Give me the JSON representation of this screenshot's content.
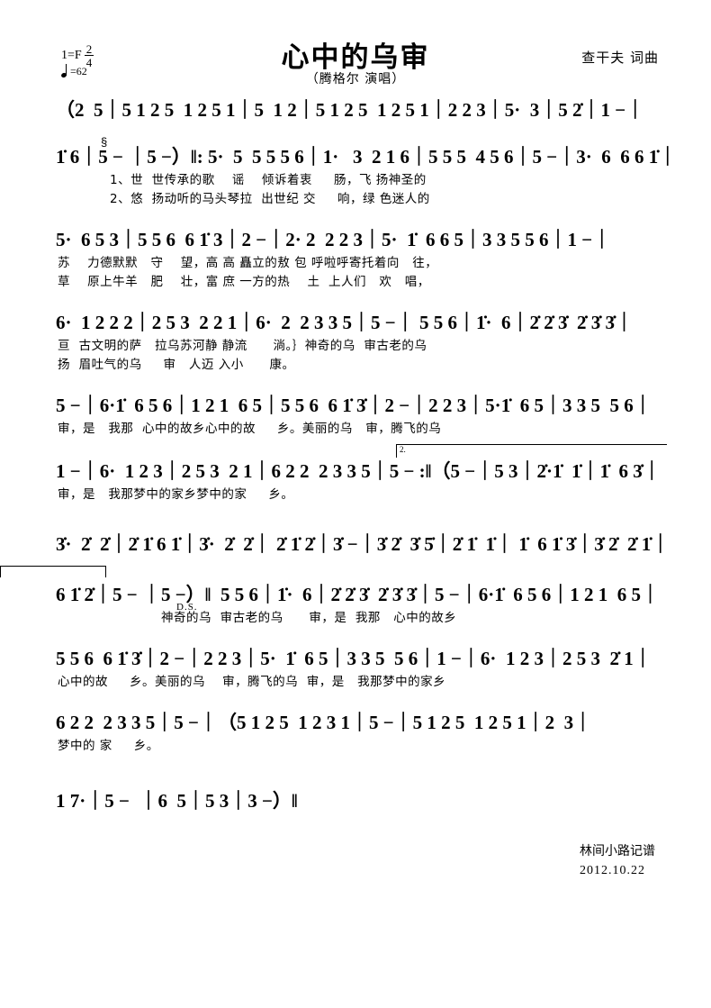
{
  "header": {
    "key_signature": "1=F",
    "time_sig_num": "2",
    "time_sig_den": "4",
    "tempo_value": "=62",
    "title": "心中的乌审",
    "subtitle": "（腾格尔 演唱）",
    "composer": "查干夫 词曲"
  },
  "markers": {
    "segno": "§",
    "ds": "D.S.",
    "ending_two": "2.",
    "verse1_number": "1、",
    "verse2_number": "2、"
  },
  "credit": {
    "transcriber": "林间小路记谱",
    "date": "2012.10.22"
  },
  "systems": [
    {
      "id": "system-1",
      "notes": "（2  5｜5 1 2 5  1 2 5 1｜5  1 2｜5 1 2 5  1 2 5 1｜2 2 3｜5·  3｜5 2̇｜1 −｜",
      "lyrics": []
    },
    {
      "id": "system-2",
      "notes": "1̇ 6｜5 − ｜5 −）‖: 5·  5  5 5 5 6｜1·   3  2 1 6｜5 5 5  4 5 6｜5 −｜3·  6  6 6 1̇｜",
      "lyrics": [
        "1、世  世传承的歌    谣    倾诉着衷     肠，飞 扬神圣的",
        "2、悠  扬动听的马头琴拉  出世纪 交     响，绿 色迷人的"
      ]
    },
    {
      "id": "system-3",
      "notes": "5·  6 5 3｜5 5 6  6 1̇ 3｜2 −｜2· 2  2 2 3｜5·  1̇  6 6 5｜3 3 5 5 6｜1 −｜",
      "lyrics": [
        "苏    力德默默   守    望，高 高 矗立的敖 包 呼啦呼寄托着向   往，",
        "草    原上牛羊   肥    壮，富 庶 一方的热    土  上人们   欢   唱，"
      ]
    },
    {
      "id": "system-4",
      "notes": "6·  1 2 2 2｜2 5 3  2 2 1｜6·  2  2 3 3 5｜5 −｜ 5 5 6｜1̇·  6｜2̇ 2̇ 3̇  2̇ 3̇ 3̇｜",
      "lyrics": [
        "亘  古文明的萨   拉乌苏河静 静流      淌。｝神奇的乌  审古老的乌",
        "扬  眉吐气的乌     审   人迈 入小      康。"
      ]
    },
    {
      "id": "system-5",
      "notes": "5 −｜6·1̇  6 5 6｜1 2 1  6 5｜5 5 6  6 1̇ 3̇｜2 −｜2 2 3｜5·1̇  6 5｜3 3 5  5 6｜",
      "lyrics": [
        "审，是   我那  心中的故乡心中的故     乡。美丽的乌   审，腾飞的乌"
      ]
    },
    {
      "id": "system-6",
      "notes": "1 −｜6·  1 2 3｜2 5 3  2 1｜6 2 2  2 3 3 5｜5 − :‖（5 −｜5 3｜2̇·1̇  1̇｜1̇  6 3̇｜",
      "lyrics": [
        "审，是   我那梦中的家乡梦中的家     乡。"
      ]
    },
    {
      "id": "system-7",
      "notes": "3̇·  2̇  2̇｜2̇ 1̇ 6 1̇｜3̇·  2̇  2̇｜ 2̇ 1̇ 2̇｜3̇ −｜3̇ 2̇  3̇ 5̇｜2̇ 1̇  1̇｜ 1̇  6 1̇ 3̇｜3̇ 2̇  2̇ 1̇｜",
      "lyrics": []
    },
    {
      "id": "system-8",
      "notes": "6 1̇ 2̇｜5 − ｜5 −）‖  5 5 6｜1̇·  6｜2̇ 2̇ 3̇  2̇ 3̇ 3̇｜5 −｜6·1̇  6 5 6｜1 2 1  6 5｜",
      "lyrics": [
        "                        神奇的乌  审古老的乌      审，是  我那   心中的故乡"
      ]
    },
    {
      "id": "system-9",
      "notes": "5 5 6  6 1̇ 3̇｜2 −｜2 2 3｜5·  1̇  6 5｜3 3 5  5 6｜1 −｜6·  1 2 3｜2 5 3  2̇ 1｜",
      "lyrics": [
        "心中的故     乡。美丽的乌    审，腾飞的乌  审，是   我那梦中的家乡"
      ]
    },
    {
      "id": "system-10",
      "notes": "6 2 2  2 3 3 5｜5 −｜（5 1 2 5  1 2 3 1｜5 −｜5 1 2 5  1 2 5 1｜2  3｜",
      "lyrics": [
        "梦中的 家     乡。"
      ]
    },
    {
      "id": "system-11",
      "notes": "1 7·｜5 −  ｜6  5｜5 3｜3 −）‖",
      "lyrics": []
    }
  ]
}
